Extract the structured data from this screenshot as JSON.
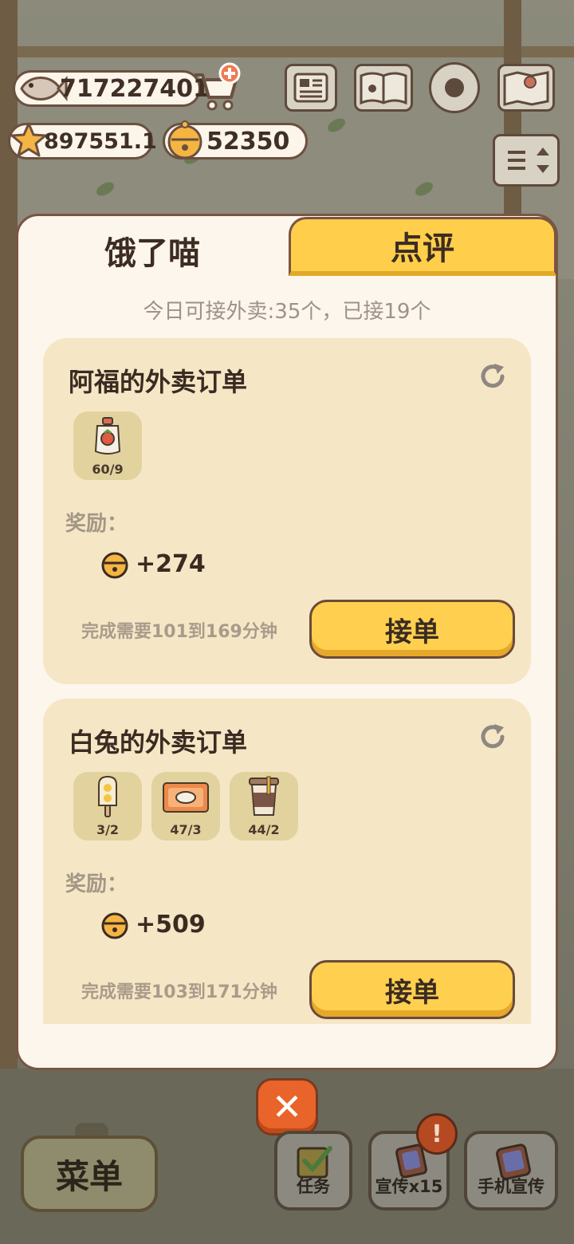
{
  "hud": {
    "fish": "717227401",
    "stars": "897551.1",
    "bells": "52350"
  },
  "tabs": [
    {
      "label": "饿了喵"
    },
    {
      "label": "点评"
    }
  ],
  "quota_text": "今日可接外卖:35个，已接19个",
  "orders": [
    {
      "title": "阿福的外卖订单",
      "items": [
        {
          "icon": "strawberry-jam-icon",
          "qty": "60/9"
        }
      ],
      "reward_label": "奖励：",
      "reward": "+274",
      "time": "完成需要101到169分钟",
      "accept_label": "接单"
    },
    {
      "title": "白兔的外卖订单",
      "items": [
        {
          "icon": "popsicle-icon",
          "qty": "3/2"
        },
        {
          "icon": "rice-tray-icon",
          "qty": "47/3"
        },
        {
          "icon": "coffee-cup-icon",
          "qty": "44/2"
        }
      ],
      "reward_label": "奖励：",
      "reward": "+509",
      "time": "完成需要103到171分钟",
      "accept_label": "接单"
    }
  ],
  "bottom": {
    "menu": "菜单",
    "tasks": "任务",
    "promo": "宣传x15",
    "phone_promo": "手机宣传",
    "badge": "!"
  },
  "colors": {
    "accent_yellow": "#ffcf4b",
    "panel": "#fdf6ec",
    "card": "#f5e6c5",
    "close_orange": "#e8642a"
  }
}
